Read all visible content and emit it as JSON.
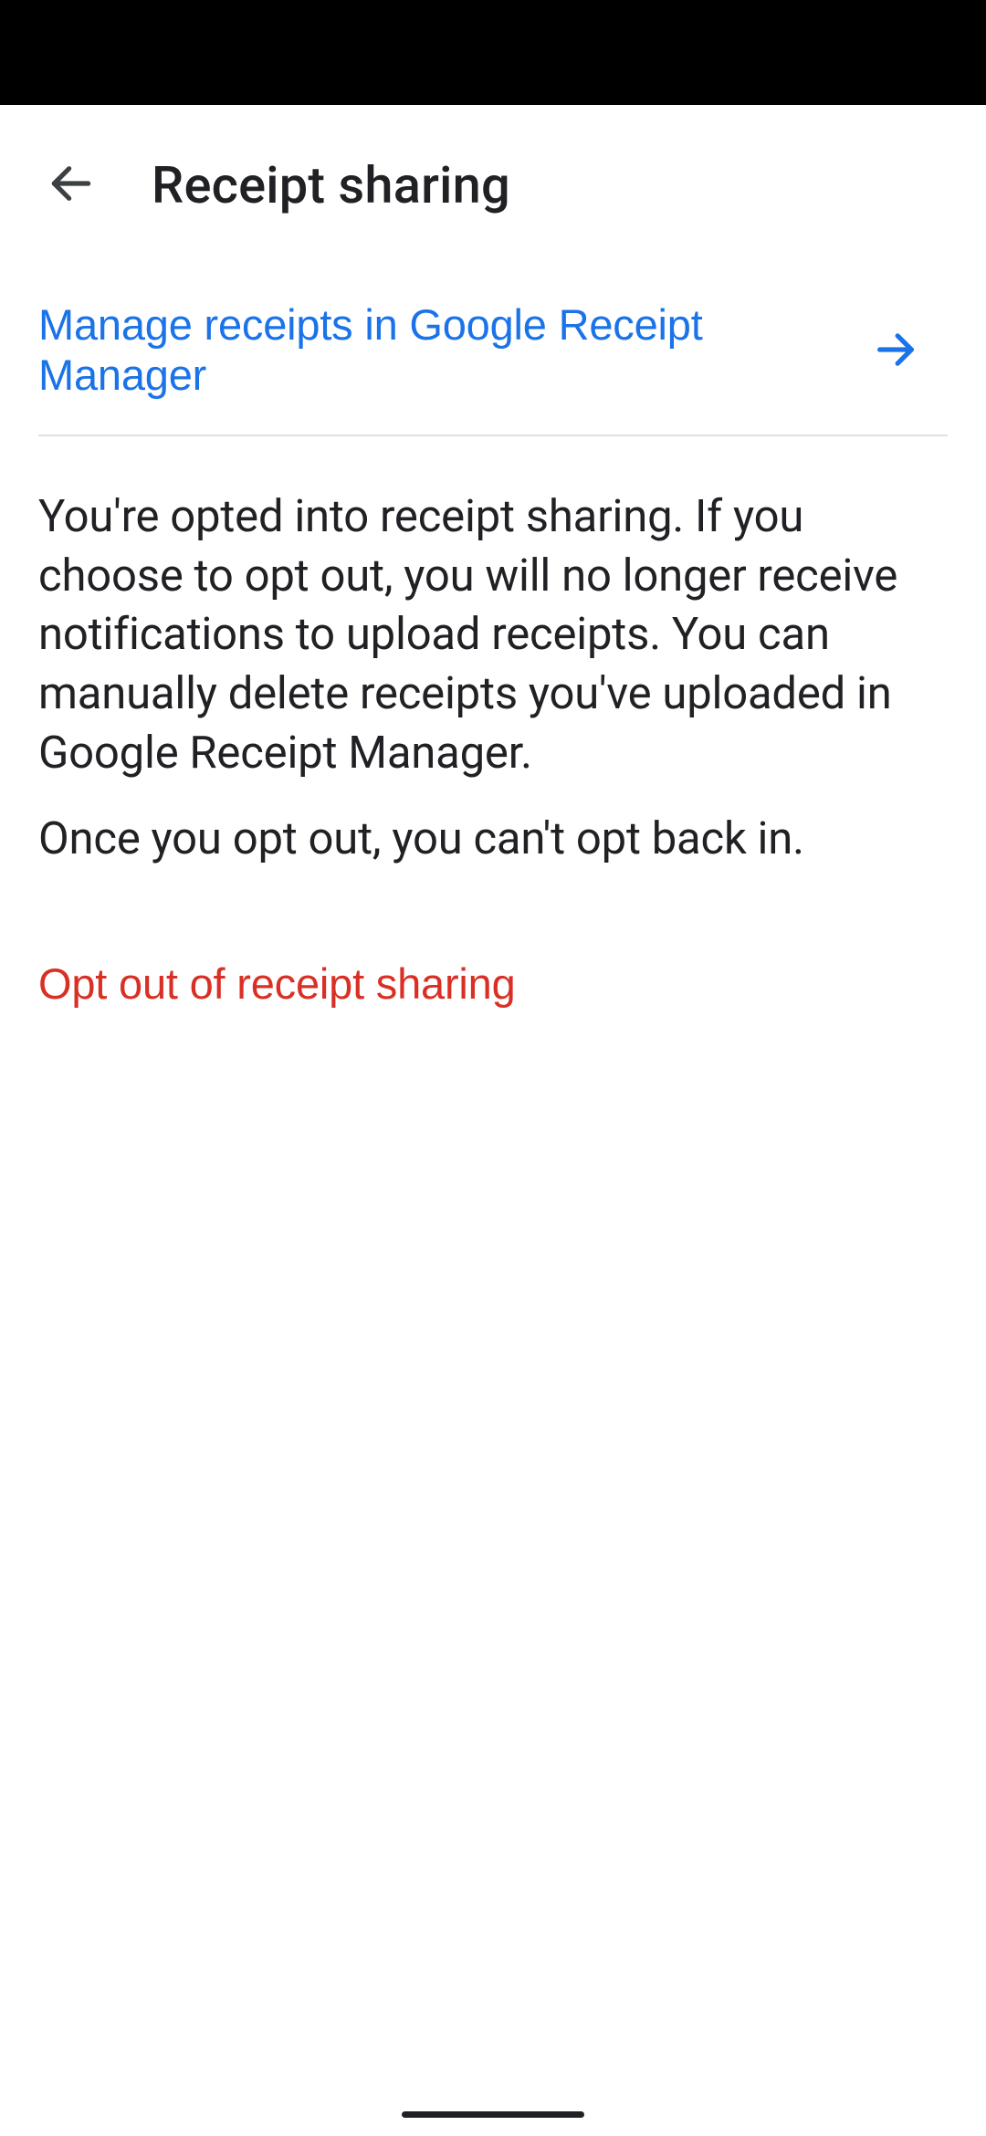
{
  "header": {
    "title": "Receipt sharing"
  },
  "manage_link": {
    "label": "Manage receipts in Google Receipt Manager"
  },
  "description": {
    "paragraph1": "You're opted into receipt sharing. If you choose to opt out, you will no longer receive notifications to upload receipts. You can manually delete receipts you've uploaded in Google Receipt Manager.",
    "paragraph2": "Once you opt out, you can't opt back in."
  },
  "opt_out": {
    "label": "Opt out of receipt sharing"
  },
  "colors": {
    "link_blue": "#1a73e8",
    "danger_red": "#d93025",
    "text_primary": "#202124"
  }
}
